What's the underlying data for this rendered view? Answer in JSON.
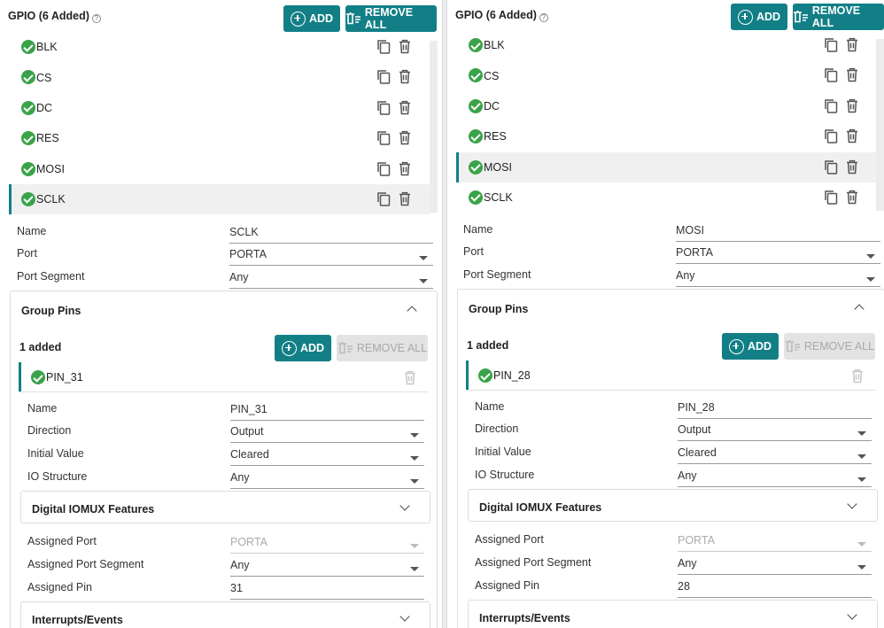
{
  "colors": {
    "accent": "#127f86",
    "success": "#3aa34a"
  },
  "left": {
    "title": "GPIO (6 Added)",
    "add_label": "ADD",
    "remove_all_label": "REMOVE ALL",
    "items": [
      {
        "label": "BLK"
      },
      {
        "label": "CS"
      },
      {
        "label": "DC"
      },
      {
        "label": "RES"
      },
      {
        "label": "MOSI"
      },
      {
        "label": "SCLK"
      }
    ],
    "selected_item": "SCLK",
    "fields": {
      "name_label": "Name",
      "name_value": "SCLK",
      "port_label": "Port",
      "port_value": "PORTA",
      "segment_label": "Port Segment",
      "segment_value": "Any"
    },
    "group_pins": {
      "title": "Group Pins",
      "count": "1 added",
      "add_label": "ADD",
      "remove_all_label": "REMOVE ALL",
      "pin_label": "PIN_31",
      "name_label": "Name",
      "name_value": "PIN_31",
      "direction_label": "Direction",
      "direction_value": "Output",
      "initial_label": "Initial Value",
      "initial_value": "Cleared",
      "io_label": "IO Structure",
      "io_value": "Any",
      "digital_title": "Digital IOMUX Features",
      "assigned_port_label": "Assigned Port",
      "assigned_port_value": "PORTA",
      "assigned_segment_label": "Assigned Port Segment",
      "assigned_segment_value": "Any",
      "assigned_pin_label": "Assigned Pin",
      "assigned_pin_value": "31",
      "interrupts_title": "Interrupts/Events"
    }
  },
  "right": {
    "title": "GPIO (6 Added)",
    "add_label": "ADD",
    "remove_all_label": "REMOVE ALL",
    "items": [
      {
        "label": "BLK"
      },
      {
        "label": "CS"
      },
      {
        "label": "DC"
      },
      {
        "label": "RES"
      },
      {
        "label": "MOSI"
      },
      {
        "label": "SCLK"
      }
    ],
    "selected_item": "MOSI",
    "fields": {
      "name_label": "Name",
      "name_value": "MOSI",
      "port_label": "Port",
      "port_value": "PORTA",
      "segment_label": "Port Segment",
      "segment_value": "Any"
    },
    "group_pins": {
      "title": "Group Pins",
      "count": "1 added",
      "add_label": "ADD",
      "remove_all_label": "REMOVE ALL",
      "pin_label": "PIN_28",
      "name_label": "Name",
      "name_value": "PIN_28",
      "direction_label": "Direction",
      "direction_value": "Output",
      "initial_label": "Initial Value",
      "initial_value": "Cleared",
      "io_label": "IO Structure",
      "io_value": "Any",
      "digital_title": "Digital IOMUX Features",
      "assigned_port_label": "Assigned Port",
      "assigned_port_value": "PORTA",
      "assigned_segment_label": "Assigned Port Segment",
      "assigned_segment_value": "Any",
      "assigned_pin_label": "Assigned Pin",
      "assigned_pin_value": "28",
      "interrupts_title": "Interrupts/Events"
    }
  }
}
